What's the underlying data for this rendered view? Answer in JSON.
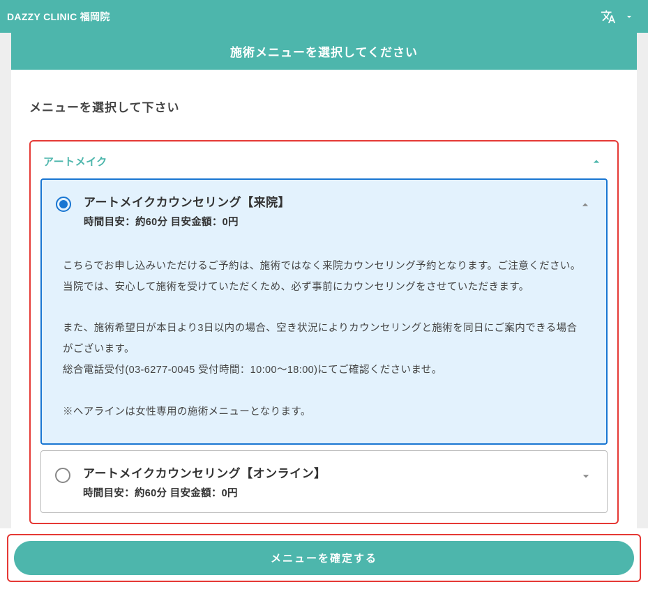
{
  "header": {
    "clinic_name": "DAZZY CLINIC 福岡院"
  },
  "step_banner": "施術メニューを選択してください",
  "instruction_text": "メニューを選択して下さい",
  "category": {
    "title": "アートメイク"
  },
  "options": [
    {
      "title": "アートメイクカウンセリング【来院】",
      "sub": "時間目安：約60分  目安金額：0円",
      "selected": true,
      "expanded": true,
      "body": {
        "p1": "こちらでお申し込みいただけるご予約は、施術ではなく来院カウンセリング予約となります。ご注意ください。",
        "p2": "当院では、安心して施術を受けていただくため、必ず事前にカウンセリングをさせていただきます。",
        "p3": "また、施術希望日が本日より3日以内の場合、空き状況によりカウンセリングと施術を同日にご案内できる場合がございます。",
        "p4": "総合電話受付(03-6277-0045 受付時間：10:00〜18:00)にてご確認くださいませ。",
        "p5": "※ヘアラインは女性専用の施術メニューとなります。"
      }
    },
    {
      "title": "アートメイクカウンセリング【オンライン】",
      "sub": "時間目安：約60分  目安金額：0円",
      "selected": false,
      "expanded": false
    }
  ],
  "footer": {
    "confirm_label": "メニューを確定する"
  },
  "colors": {
    "primary": "#4db6ac",
    "highlight_border": "#e53935",
    "selected_border": "#1976d2",
    "selected_bg": "#e3f2fd"
  }
}
